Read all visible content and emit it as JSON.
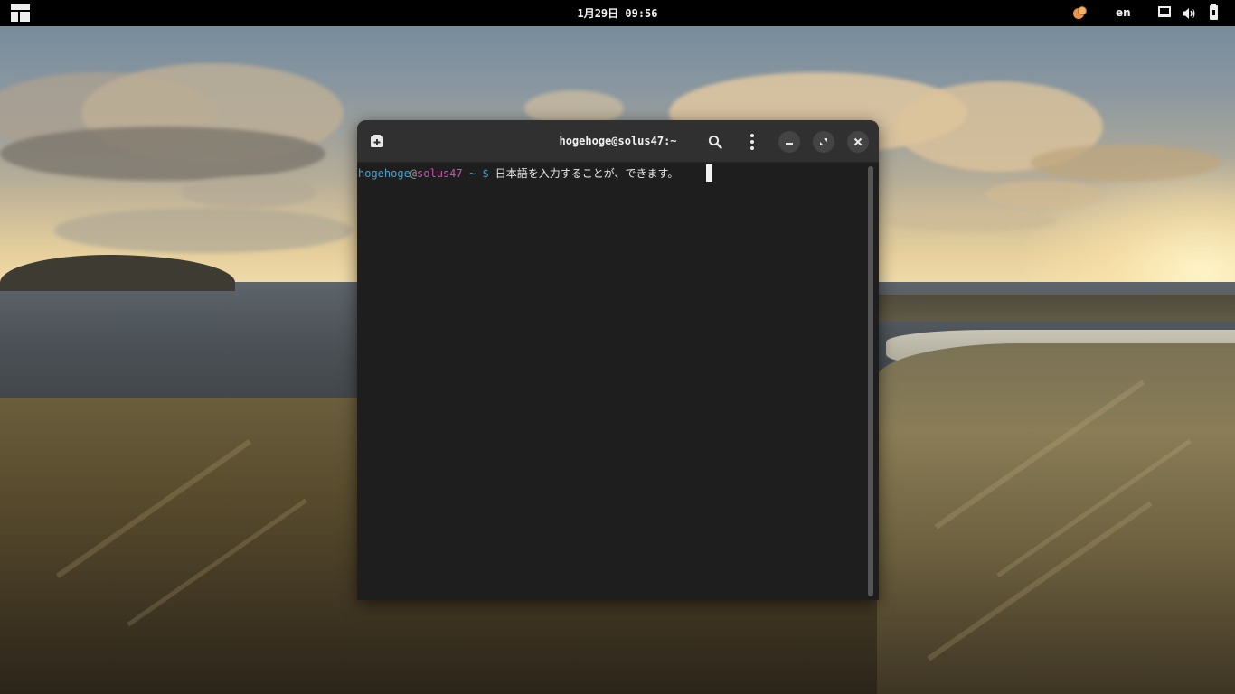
{
  "topbar": {
    "menu_icon": "applications-menu-icon",
    "clock": "1月29日 09:56",
    "language": "en",
    "tray_icons": [
      "app-indicator-icon",
      "display-icon",
      "volume-icon",
      "battery-icon"
    ]
  },
  "terminal": {
    "title": "hogehoge@solus47:~",
    "prompt": {
      "user": "hogehoge",
      "at": "@",
      "host": "solus47",
      "path": "~",
      "symbol": "$",
      "command": "日本語を入力することが、できます。"
    },
    "header_icons": [
      "new-tab-icon",
      "search-icon",
      "more-menu-icon",
      "minimize-icon",
      "maximize-icon",
      "close-icon"
    ]
  },
  "colors": {
    "topbar_bg": "#000000",
    "headerbar_bg": "#303030",
    "terminal_bg": "#1e1e1e",
    "prompt_user": "#3fa7d6",
    "prompt_host": "#d04fb4"
  }
}
